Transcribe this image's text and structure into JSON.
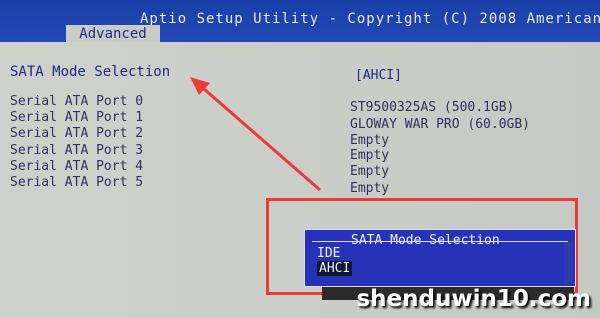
{
  "header": {
    "title": "Aptio Setup Utility - Copyright (C) 2008 American",
    "active_tab": "Advanced"
  },
  "sata_mode": {
    "label": "SATA Mode Selection",
    "value": "[AHCI]"
  },
  "ports": [
    {
      "label": "Serial ATA Port 0",
      "value": "ST9500325AS      (500.1GB)"
    },
    {
      "label": "Serial ATA Port 1",
      "value": "GLOWAY WAR PRO (60.0GB)"
    },
    {
      "label": "Serial ATA Port 2",
      "value": "Empty"
    },
    {
      "label": "Serial ATA Port 3",
      "value": "Empty"
    },
    {
      "label": "Serial ATA Port 4",
      "value": "Empty"
    },
    {
      "label": "Serial ATA Port 5",
      "value": "Empty"
    }
  ],
  "popup": {
    "title": "SATA Mode Selection",
    "options": [
      "IDE",
      "AHCI"
    ],
    "selected": "AHCI"
  },
  "watermark": "shenduwin10.com",
  "colors": {
    "title_bar": "#2248b5",
    "popup_bg": "#2633b8",
    "annotation_red": "#ec3a3a",
    "text_dark": "#30315e",
    "bios_bg": "#c9cbc6"
  },
  "icons": [
    "red-arrow-icon"
  ]
}
